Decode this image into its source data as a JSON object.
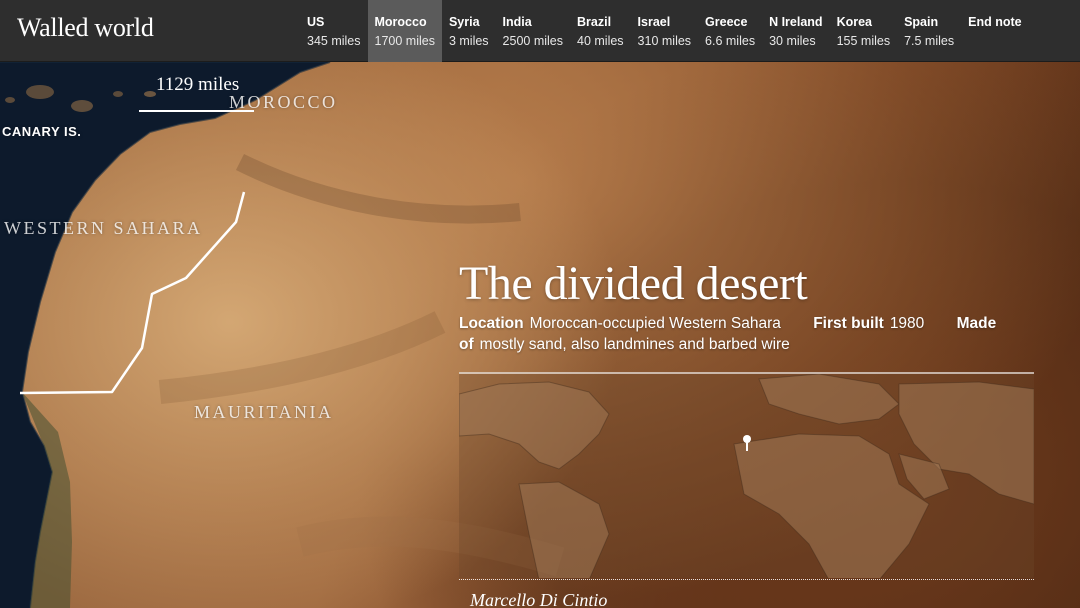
{
  "app": {
    "title": "Walled world"
  },
  "nav": [
    {
      "name": "US",
      "miles": "345 miles",
      "active": false
    },
    {
      "name": "Morocco",
      "miles": "1700 miles",
      "active": true
    },
    {
      "name": "Syria",
      "miles": "3 miles",
      "active": false
    },
    {
      "name": "India",
      "miles": "2500 miles",
      "active": false
    },
    {
      "name": "Brazil",
      "miles": "40 miles",
      "active": false
    },
    {
      "name": "Israel",
      "miles": "310 miles",
      "active": false
    },
    {
      "name": "Greece",
      "miles": "6.6 miles",
      "active": false
    },
    {
      "name": "N Ireland",
      "miles": "30 miles",
      "active": false
    },
    {
      "name": "Korea",
      "miles": "155 miles",
      "active": false
    },
    {
      "name": "Spain",
      "miles": "7.5 miles",
      "active": false
    },
    {
      "name": "End note",
      "miles": "",
      "active": false
    }
  ],
  "map": {
    "scale_label": "1129 miles",
    "places": {
      "morocco": "MOROCCO",
      "canary": "CANARY IS.",
      "western_sahara": "WESTERN SAHARA",
      "mauritania": "MAURITANIA"
    }
  },
  "article": {
    "headline": "The divided desert",
    "facts": {
      "location_key": "Location",
      "location_value": "Moroccan-occupied Western Sahara",
      "built_key": "First built",
      "built_value": "1980",
      "made_key": "Made of",
      "made_value": "mostly sand, also landmines and barbed wire"
    },
    "byline": "Marcello Di Cintio"
  },
  "colors": {
    "nav_bg": "#2e2e2e",
    "nav_active": "#5b5b5b",
    "ocean": "#0d1a2c",
    "desert": "#c99a68"
  }
}
